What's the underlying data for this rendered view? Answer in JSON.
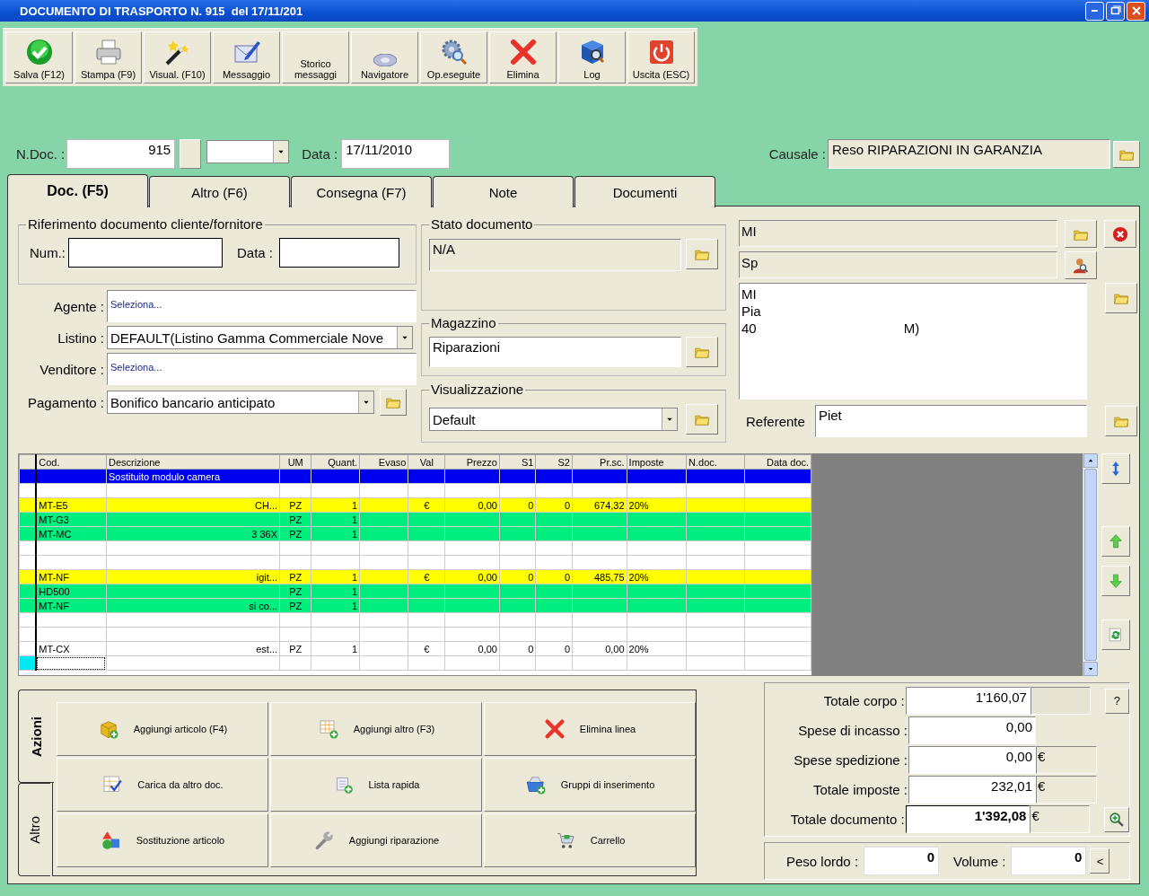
{
  "window": {
    "title": "DOCUMENTO DI TRASPORTO N. 915  del 17/11/201"
  },
  "toolbar": [
    {
      "kind": "save",
      "label": "Salva (F12)"
    },
    {
      "kind": "print",
      "label": "Stampa (F9)"
    },
    {
      "kind": "preview",
      "label": "Visual. (F10)"
    },
    {
      "kind": "message",
      "label": "Messaggio"
    },
    {
      "kind": "history",
      "label": "Storico messaggi"
    },
    {
      "kind": "navigator",
      "label": "Navigatore"
    },
    {
      "kind": "operations",
      "label": "Op.eseguite"
    },
    {
      "kind": "delete",
      "label": "Elimina"
    },
    {
      "kind": "log",
      "label": "Log"
    },
    {
      "kind": "exit",
      "label": "Uscita (ESC)"
    }
  ],
  "header": {
    "number_label": "N.Doc. :",
    "number": "915",
    "date_label": "Data :",
    "date": "17/11/2010",
    "reason_label": "Causale :",
    "reason": "Reso RIPARAZIONI IN GARANZIA"
  },
  "tabs": [
    {
      "label": "Doc. (F5)",
      "selected": true
    },
    {
      "label": "Altro (F6)",
      "selected": false
    },
    {
      "label": "Consegna (F7)",
      "selected": false
    },
    {
      "label": "Note",
      "selected": false
    },
    {
      "label": "Documenti",
      "selected": false
    }
  ],
  "reference": {
    "title": "Riferimento documento cliente/fornitore",
    "number_label": "Num.:",
    "date_label": "Data :"
  },
  "fields": [
    {
      "kind": "picker",
      "label": "Agente :",
      "value": "Seleziona..."
    },
    {
      "kind": "dropdown",
      "label": "Listino :",
      "value": "DEFAULT(Listino Gamma Commerciale Nove"
    },
    {
      "kind": "picker",
      "label": "Venditore :",
      "value": "Seleziona..."
    },
    {
      "kind": "dropdown-folder",
      "label": "Pagamento :",
      "value": "Bonifico bancario anticipato"
    }
  ],
  "status": {
    "title": "Stato documento",
    "value": "N/A"
  },
  "warehouse": {
    "title": "Magazzino",
    "value": "Riparazioni"
  },
  "view": {
    "title": "Visualizzazione",
    "value": "Default"
  },
  "customer": {
    "name": "MI",
    "second_line": "Sp",
    "address_lines": [
      {
        "start": "MI"
      },
      {
        "start": "Pia"
      },
      {
        "start": "40",
        "end": "M)"
      }
    ],
    "contact_label": "Referente",
    "contact": "Piet"
  },
  "grid": {
    "columns": [
      "Cod.",
      "Descrizione",
      "UM",
      "Quant.",
      "Evaso",
      "Val",
      "Prezzo",
      "S1",
      "S2",
      "Pr.sc.",
      "Imposte",
      "N.doc.",
      "Data doc."
    ],
    "rows": [
      {
        "selected": true,
        "cells": [
          null,
          "Sostituito modulo camera"
        ]
      },
      {
        "selected": false,
        "cells": []
      },
      {
        "selected": false,
        "color": "#ffff00",
        "partly_hidden": true,
        "cells": [
          "MT-E5",
          "CH...",
          "PZ",
          "1",
          null,
          "€",
          "0,00",
          "0",
          "0",
          "674,32",
          "20%"
        ]
      },
      {
        "selected": false,
        "color": "#00ee80",
        "cells": [
          "MT-G3",
          null,
          "PZ",
          "1"
        ]
      },
      {
        "selected": false,
        "color": "#00ee80",
        "partly_hidden": true,
        "cells": [
          "MT-MC",
          "3 36X",
          "PZ",
          "1"
        ]
      },
      {
        "selected": false,
        "cells": []
      },
      {
        "selected": false,
        "cells": []
      },
      {
        "selected": false,
        "color": "#ffff00",
        "partly_hidden": true,
        "cells": [
          "MT-NF",
          "igit...",
          "PZ",
          "1",
          null,
          "€",
          "0,00",
          "0",
          "0",
          "485,75",
          "20%"
        ]
      },
      {
        "selected": false,
        "color": "#00ee80",
        "cells": [
          "HD500",
          null,
          "PZ",
          "1"
        ]
      },
      {
        "selected": false,
        "color": "#00ee80",
        "partly_hidden": true,
        "cells": [
          "MT-NF",
          "si co...",
          "PZ",
          "1"
        ]
      },
      {
        "selected": false,
        "cells": []
      },
      {
        "selected": false,
        "cells": []
      },
      {
        "selected": false,
        "partly_hidden": true,
        "cells": [
          "MT-CX",
          "est...",
          "PZ",
          "1",
          null,
          "€",
          "0,00",
          "0",
          "0",
          "0,00",
          "20%"
        ]
      },
      {
        "selected": false,
        "current": true,
        "cells": []
      }
    ]
  },
  "actions": {
    "tabs": [
      {
        "label": "Azioni",
        "selected": true
      },
      {
        "label": "Altro",
        "selected": false
      }
    ],
    "buttons": [
      {
        "kind": "add-item",
        "label": "Aggiungi articolo (F4)"
      },
      {
        "kind": "add-other",
        "label": "Aggiungi altro (F3)"
      },
      {
        "kind": "delete-line",
        "label": "Elimina linea"
      },
      {
        "kind": "load",
        "label": "Carica da altro doc."
      },
      {
        "kind": "quick-list",
        "label": "Lista rapida"
      },
      {
        "kind": "groups",
        "label": "Gruppi di inserimento"
      },
      {
        "kind": "replace",
        "label": "Sostituzione articolo"
      },
      {
        "kind": "repair",
        "label": "Aggiungi riparazione"
      },
      {
        "kind": "cart",
        "label": "Carrello"
      }
    ]
  },
  "totals": {
    "rows": [
      {
        "label": "Totale corpo :",
        "value": "1'160,07",
        "unit_box": true,
        "button": {
          "kind": "help",
          "label": "?"
        }
      },
      {
        "label": "Spese di incasso :",
        "value": "0,00",
        "unit_box": false
      },
      {
        "label": "Spese spedizione :",
        "value": "0,00",
        "unit_box": true,
        "unit": "€"
      },
      {
        "label": "Totale imposte :",
        "value": "232,01",
        "unit_box": true,
        "unit": "€"
      },
      {
        "label": "Totale documento :",
        "value": "1'392,08",
        "unit_box": true,
        "unit": "€",
        "emphasis": true,
        "button": {
          "kind": "zoom"
        }
      }
    ],
    "weight_label": "Peso lordo :",
    "weight": "0",
    "volume_label": "Volume :",
    "volume": "0",
    "more_label": "<"
  }
}
